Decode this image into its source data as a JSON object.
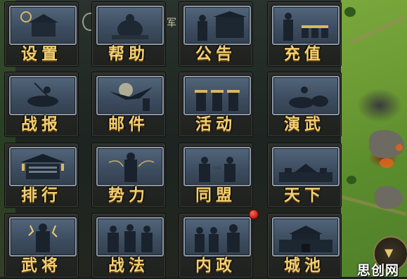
{
  "menu": {
    "tiles": [
      {
        "label": "设置",
        "icon": "settings-icon"
      },
      {
        "label": "帮助",
        "icon": "help-icon"
      },
      {
        "label": "公告",
        "icon": "announcement-icon"
      },
      {
        "label": "充值",
        "icon": "recharge-icon"
      },
      {
        "label": "战报",
        "icon": "battle-report-icon"
      },
      {
        "label": "邮件",
        "icon": "mail-icon"
      },
      {
        "label": "活动",
        "icon": "events-icon"
      },
      {
        "label": "演武",
        "icon": "drill-icon"
      },
      {
        "label": "排行",
        "icon": "ranking-icon"
      },
      {
        "label": "势力",
        "icon": "faction-icon"
      },
      {
        "label": "同盟",
        "icon": "alliance-icon"
      },
      {
        "label": "天下",
        "icon": "world-icon"
      },
      {
        "label": "武将",
        "icon": "generals-icon"
      },
      {
        "label": "战法",
        "icon": "tactics-icon"
      },
      {
        "label": "内政",
        "icon": "domestic-icon"
      },
      {
        "label": "城池",
        "icon": "city-icon"
      }
    ]
  },
  "background": {
    "partial_tab_text": "军"
  },
  "watermark": "思创网",
  "colors": {
    "label_gold": "#f1cf72",
    "badge_red": "#d0221a",
    "frame_blue": "#4a5d72"
  }
}
